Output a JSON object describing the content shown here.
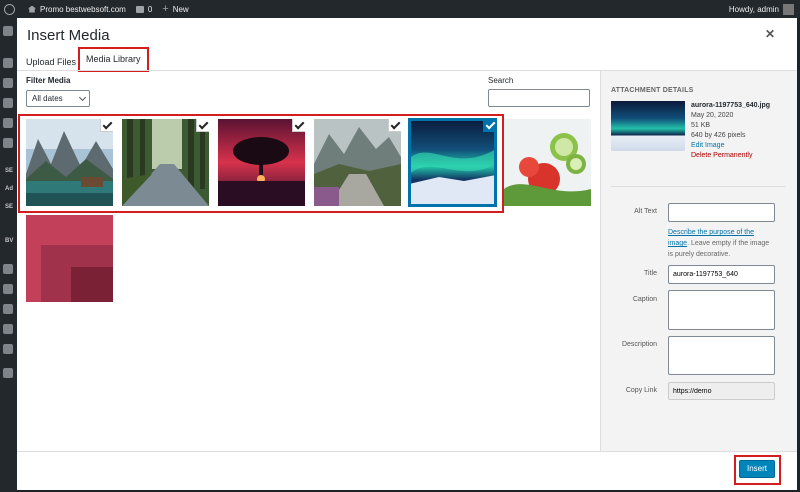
{
  "adminbar": {
    "site_name": "Promo bestwebsoft.com",
    "comments_count": "0",
    "new_label": "New",
    "howdy": "Howdy, admin"
  },
  "adminmenu": {
    "items": [
      "SE",
      "Ad",
      "SE",
      "BV"
    ]
  },
  "modal": {
    "title": "Insert Media",
    "tabs": [
      {
        "label": "Upload Files",
        "selected": false
      },
      {
        "label": "Media Library",
        "selected": true
      }
    ]
  },
  "filter": {
    "label": "Filter Media",
    "selected": "All dates"
  },
  "search": {
    "label": "Search",
    "value": ""
  },
  "media_items": [
    {
      "id": "lake-mountains",
      "checked": true,
      "active": false
    },
    {
      "id": "forest-road",
      "checked": true,
      "active": false
    },
    {
      "id": "tree-sunset",
      "checked": true,
      "active": false
    },
    {
      "id": "stone-path",
      "checked": true,
      "active": false
    },
    {
      "id": "aurora",
      "checked": true,
      "active": true
    },
    {
      "id": "cucumber-tomato",
      "checked": false,
      "active": false
    },
    {
      "id": "pink-square",
      "checked": false,
      "active": false
    }
  ],
  "attachment": {
    "heading": "ATTACHMENT DETAILS",
    "filename": "aurora-1197753_640.jpg",
    "date": "May 20, 2020",
    "filesize": "51 KB",
    "dimensions": "640 by 426 pixels",
    "edit_link": "Edit Image",
    "delete_link": "Delete Permanently",
    "alt_label": "Alt Text",
    "alt_value": "",
    "alt_help_link": "Describe the purpose of the image",
    "alt_help_rest": ". Leave empty if the image is purely decorative.",
    "title_label": "Title",
    "title_value": "aurora-1197753_640",
    "caption_label": "Caption",
    "caption_value": "",
    "description_label": "Description",
    "description_value": "",
    "copylink_label": "Copy Link",
    "copylink_value": "https://demo"
  },
  "footer": {
    "insert_label": "Insert"
  },
  "colors": {
    "accent": "#0073aa",
    "button": "#0085ba",
    "highlight": "#d21e1e",
    "delete": "#aa0000"
  }
}
